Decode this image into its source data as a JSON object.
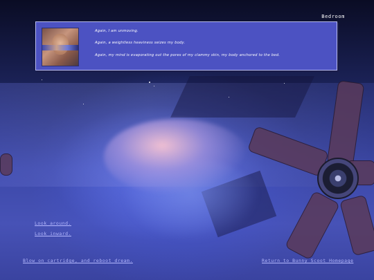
{
  "location": "Bedroom",
  "dialog": {
    "lines": [
      "Again, I am unmoving.",
      "Again, a weightless heaviness seizes my body.",
      "Again, my mind is evaporating out the pores of my clammy skin, my body anchored to the bed."
    ]
  },
  "choices": [
    "Look around.",
    "Look inward."
  ],
  "footer": {
    "reboot": "Blow on cartridge, and reboot dream.",
    "home": "Return to Bunny Scoot Homepage"
  }
}
